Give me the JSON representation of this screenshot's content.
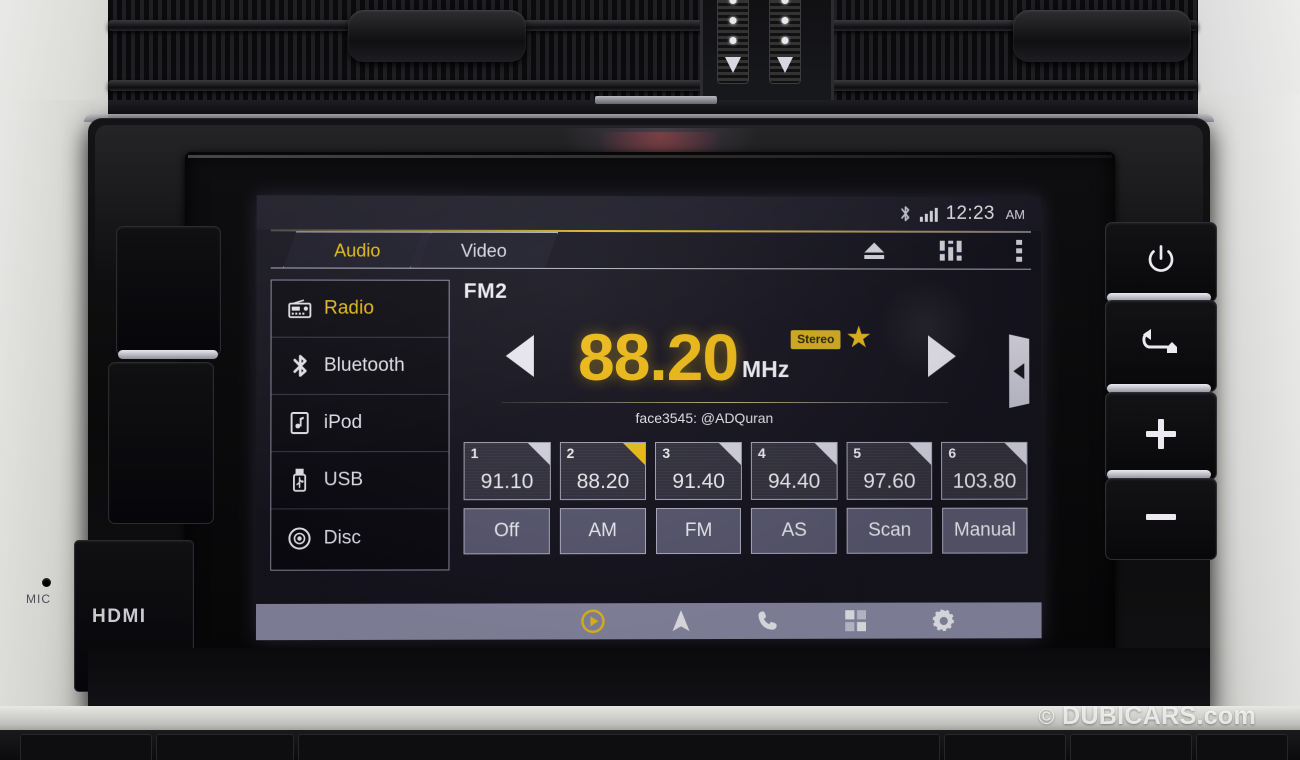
{
  "status_bar": {
    "bluetooth_icon": "bluetooth-icon",
    "signal_icon": "signal-bars-icon",
    "time": "12:23",
    "meridiem": "AM"
  },
  "tabs": [
    {
      "label": "Audio",
      "active": true
    },
    {
      "label": "Video",
      "active": false
    }
  ],
  "header_icons": [
    {
      "name": "eject-icon"
    },
    {
      "name": "equalizer-icon"
    },
    {
      "name": "more-options-icon"
    }
  ],
  "sidebar": {
    "items": [
      {
        "label": "Radio",
        "icon": "radio-icon",
        "active": true
      },
      {
        "label": "Bluetooth",
        "icon": "bluetooth-icon",
        "active": false
      },
      {
        "label": "iPod",
        "icon": "ipod-icon",
        "active": false
      },
      {
        "label": "USB",
        "icon": "usb-icon",
        "active": false
      },
      {
        "label": "Disc",
        "icon": "disc-icon",
        "active": false
      }
    ]
  },
  "now_playing": {
    "band": "FM2",
    "frequency": "88.20",
    "unit": "MHz",
    "stereo_badge": "Stereo",
    "favorite_icon": "star-icon",
    "rds_text": "face3545: @ADQuran",
    "prev_icon": "prev-arrow-icon",
    "next_icon": "next-arrow-icon",
    "side_tab_icon": "collapse-left-icon"
  },
  "presets": [
    {
      "num": "1",
      "value": "91.10",
      "selected": false
    },
    {
      "num": "2",
      "value": "88.20",
      "selected": true
    },
    {
      "num": "3",
      "value": "91.40",
      "selected": false
    },
    {
      "num": "4",
      "value": "94.40",
      "selected": false
    },
    {
      "num": "5",
      "value": "97.60",
      "selected": false
    },
    {
      "num": "6",
      "value": "103.80",
      "selected": false
    }
  ],
  "modes": [
    {
      "label": "Off"
    },
    {
      "label": "AM"
    },
    {
      "label": "FM"
    },
    {
      "label": "AS"
    },
    {
      "label": "Scan"
    },
    {
      "label": "Manual"
    }
  ],
  "nav_bar": [
    {
      "name": "media-play-icon"
    },
    {
      "name": "navigation-arrow-icon"
    },
    {
      "name": "phone-icon"
    },
    {
      "name": "apps-grid-icon"
    },
    {
      "name": "settings-gear-icon"
    }
  ],
  "hardware": {
    "right_buttons": [
      {
        "name": "power-button",
        "glyph": "power"
      },
      {
        "name": "back-home-button",
        "glyph": "back"
      },
      {
        "name": "volume-up-button",
        "glyph": "plus"
      },
      {
        "name": "volume-down-button",
        "glyph": "minus"
      }
    ],
    "mic_label": "MIC",
    "hdmi_label": "HDMI"
  },
  "watermark": {
    "copyright": "©",
    "text": "DUBICARS.com"
  },
  "colors": {
    "accent_yellow": "#f0c319",
    "screen_bg": "#16141f",
    "nav_bar": "#8d8ca8",
    "mode_button": "#5b5a72"
  }
}
